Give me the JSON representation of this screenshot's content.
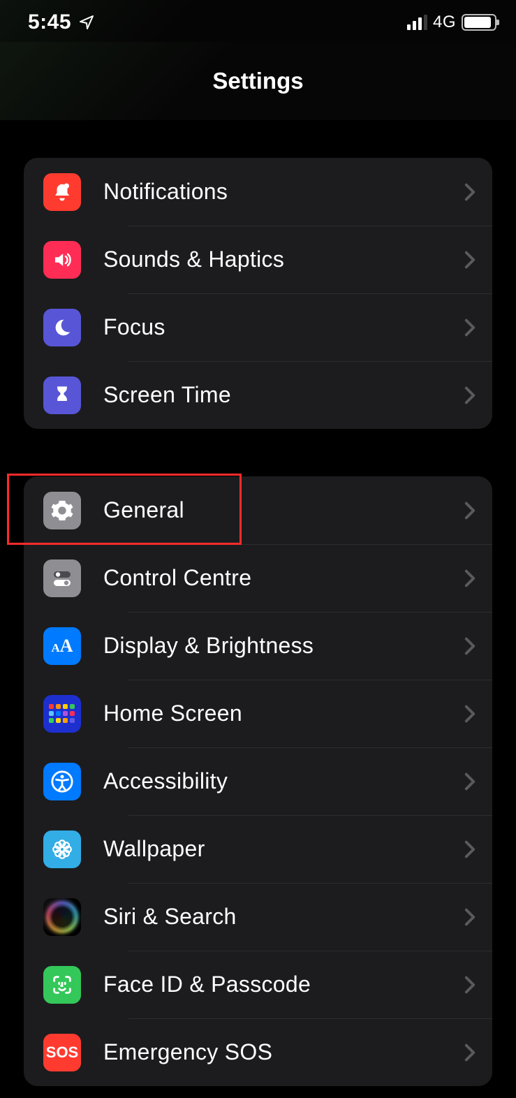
{
  "status": {
    "time": "5:45",
    "network": "4G"
  },
  "header": {
    "title": "Settings"
  },
  "groups": [
    {
      "items": [
        {
          "label": "Notifications",
          "icon": "bell-icon"
        },
        {
          "label": "Sounds & Haptics",
          "icon": "speaker-icon"
        },
        {
          "label": "Focus",
          "icon": "moon-icon"
        },
        {
          "label": "Screen Time",
          "icon": "hourglass-icon"
        }
      ]
    },
    {
      "items": [
        {
          "label": "General",
          "icon": "gear-icon",
          "highlighted": true
        },
        {
          "label": "Control Centre",
          "icon": "toggles-icon"
        },
        {
          "label": "Display & Brightness",
          "icon": "text-size-icon"
        },
        {
          "label": "Home Screen",
          "icon": "home-grid-icon"
        },
        {
          "label": "Accessibility",
          "icon": "accessibility-icon"
        },
        {
          "label": "Wallpaper",
          "icon": "flower-icon"
        },
        {
          "label": "Siri & Search",
          "icon": "siri-icon"
        },
        {
          "label": "Face ID & Passcode",
          "icon": "face-id-icon"
        },
        {
          "label": "Emergency SOS",
          "icon": "sos-icon"
        }
      ]
    }
  ]
}
